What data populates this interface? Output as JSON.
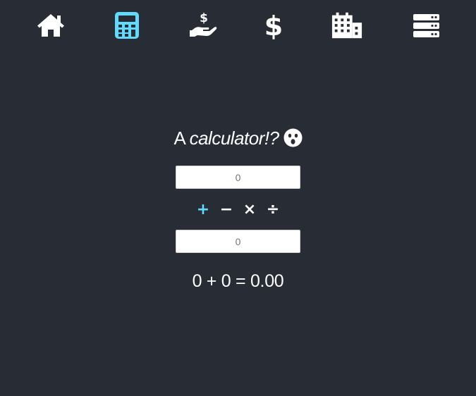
{
  "nav": {
    "items": [
      {
        "icon": "home-icon",
        "active": false
      },
      {
        "icon": "calculator-icon",
        "active": true
      },
      {
        "icon": "hand-holding-dollar-icon",
        "active": false
      },
      {
        "icon": "dollar-sign-icon",
        "active": false
      },
      {
        "icon": "building-icon",
        "active": false
      },
      {
        "icon": "server-icon",
        "active": false
      }
    ],
    "active_color": "#61dafb",
    "color": "#ffffff"
  },
  "calculator": {
    "title_prefix": "A",
    "title_emphasis": "calculator!?",
    "title_emoji": "astonished-face-icon",
    "first_operand": {
      "value": "",
      "placeholder": "0"
    },
    "operators": [
      {
        "symbol": "+",
        "name": "add",
        "active": true
      },
      {
        "symbol": "−",
        "name": "subtract",
        "active": false
      },
      {
        "symbol": "×",
        "name": "multiply",
        "active": false
      },
      {
        "symbol": "÷",
        "name": "divide",
        "active": false
      }
    ],
    "second_operand": {
      "value": "",
      "placeholder": "0"
    },
    "result_text": "0 + 0 = 0.00"
  },
  "colors": {
    "background": "#282c34",
    "accent": "#61dafb",
    "text": "#ffffff"
  }
}
